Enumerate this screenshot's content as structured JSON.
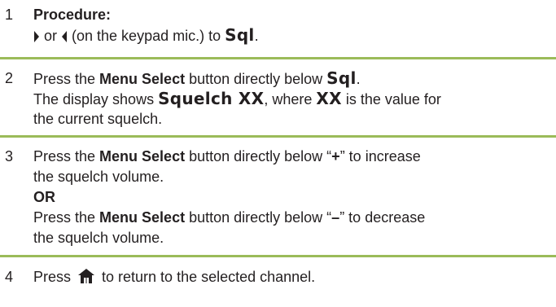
{
  "steps": [
    {
      "number": "1",
      "heading": "Procedure:",
      "line_or": " or ",
      "line_mid": " (on the keypad mic.) to ",
      "line_sql": "Sql",
      "line_end": "."
    },
    {
      "number": "2",
      "l1_a": "Press the ",
      "l1_b": "Menu Select",
      "l1_c": " button directly below ",
      "l1_d": "Sql",
      "l1_e": ".",
      "l2_a": "The display shows ",
      "l2_b": "Squelch XX",
      "l2_c": ", where ",
      "l2_d": "XX",
      "l2_e": " is the value for",
      "l3": "the current squelch."
    },
    {
      "number": "3",
      "l1_a": "Press the ",
      "l1_b": "Menu Select",
      "l1_c": " button directly below “",
      "l1_d": "+",
      "l1_e": "” to increase",
      "l2": "the squelch volume.",
      "or_label": "OR",
      "l4_a": "Press the ",
      "l4_b": "Menu Select",
      "l4_c": " button directly below “",
      "l4_d": "–",
      "l4_e": "” to decrease",
      "l5": "the squelch volume."
    },
    {
      "number": "4",
      "l1_a": "Press ",
      "l1_b": " to return to the selected channel."
    }
  ],
  "icons": {
    "right_arrow": "right-arrow-icon",
    "left_arrow": "left-arrow-icon",
    "home": "home-icon"
  },
  "colors": {
    "rule": "#9bbb59",
    "text": "#231f20"
  }
}
